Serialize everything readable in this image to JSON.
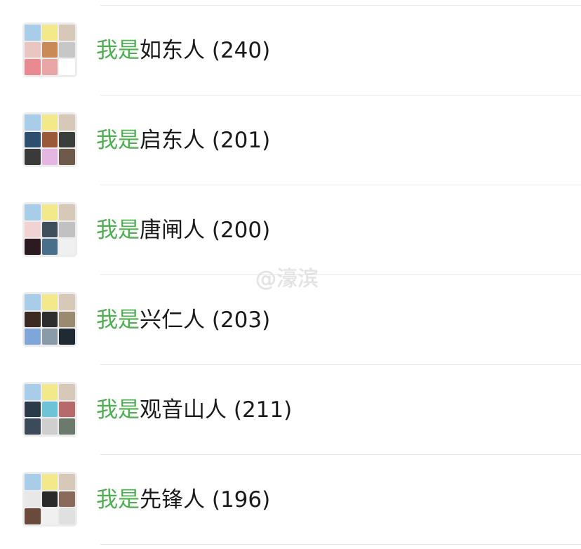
{
  "groups": [
    {
      "prefix": "我是",
      "name": "如东人",
      "count": "(240)",
      "avatar_colors": [
        "#a7cde8",
        "#f3e98a",
        "#d8c8b8",
        "#e9c6c1",
        "#c98a57",
        "#c7c7c7",
        "#e88a8f",
        "#e8a6a6",
        "#ffffff"
      ]
    },
    {
      "prefix": "我是",
      "name": "启东人",
      "count": "(201)",
      "avatar_colors": [
        "#a7cde8",
        "#f3e98a",
        "#d8c8b8",
        "#2d4f6e",
        "#9a5a3a",
        "#3a3f3a",
        "#3a3a3a",
        "#e6b6e2",
        "#6d5a4a"
      ]
    },
    {
      "prefix": "我是",
      "name": "唐闸人",
      "count": "(200)",
      "avatar_colors": [
        "#a7cde8",
        "#f3e98a",
        "#d8c8b8",
        "#f1d3d3",
        "#3f4f5c",
        "#c1c1c1",
        "#2b1a1f",
        "#4a6f8a",
        "#f0f0f0"
      ]
    },
    {
      "prefix": "我是",
      "name": "兴仁人",
      "count": "(203)",
      "avatar_colors": [
        "#a7cde8",
        "#f3e98a",
        "#d8c8b8",
        "#3b2a22",
        "#2e2e2e",
        "#9a8a70",
        "#7fa6d8",
        "#8a9aa6",
        "#1f2a33"
      ]
    },
    {
      "prefix": "我是",
      "name": "观音山人",
      "count": "(211)",
      "avatar_colors": [
        "#a7cde8",
        "#f3e98a",
        "#d8c8b8",
        "#2a3a4a",
        "#6fc3d6",
        "#b86a6a",
        "#3b4b5b",
        "#cfcfcf",
        "#6c7a6c"
      ]
    },
    {
      "prefix": "我是",
      "name": "先锋人",
      "count": "(196)",
      "avatar_colors": [
        "#a7cde8",
        "#f3e98a",
        "#d8c8b8",
        "#e8e8e8",
        "#2a2a2a",
        "#8a6a5a",
        "#6a4a3a",
        "#f0f0f0",
        "#e0e0e0"
      ]
    }
  ],
  "watermark": "@濠滨"
}
